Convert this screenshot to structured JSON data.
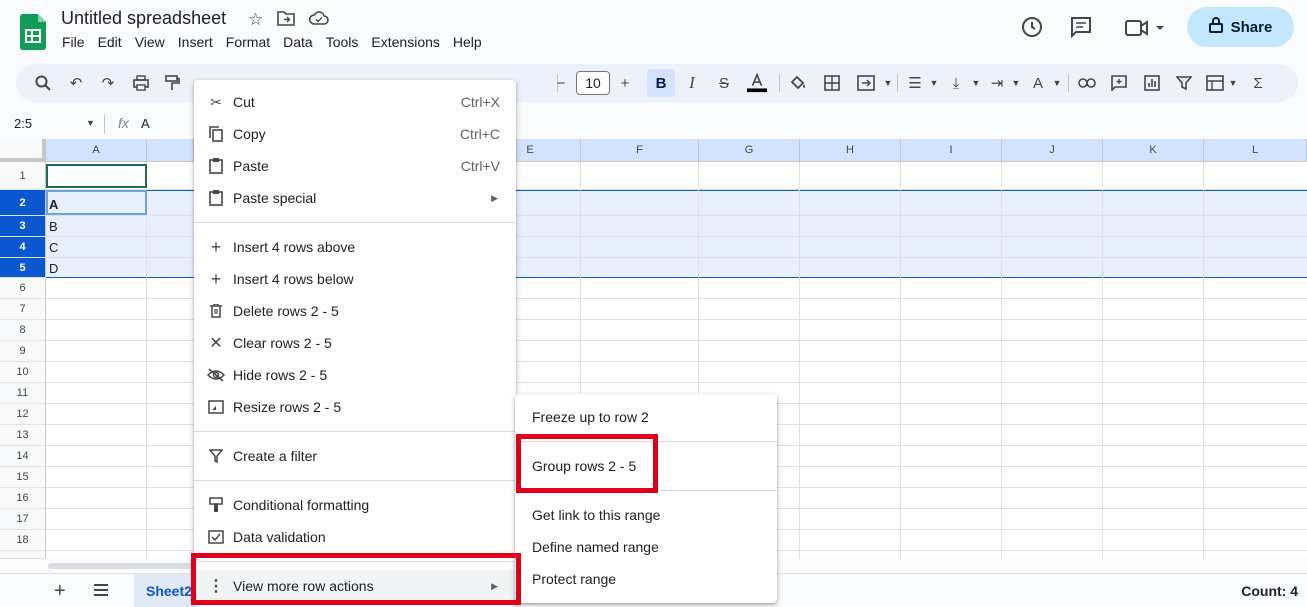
{
  "header": {
    "title": "Untitled spreadsheet",
    "menu": [
      "File",
      "Edit",
      "View",
      "Insert",
      "Format",
      "Data",
      "Tools",
      "Extensions",
      "Help"
    ],
    "share_label": "Share"
  },
  "toolbar": {
    "font_size": "10",
    "bold_label": "B"
  },
  "formula_bar": {
    "name_box": "2:5",
    "fx": "fx",
    "value": "A"
  },
  "grid": {
    "columns": [
      "A",
      "",
      "",
      "",
      "E",
      "F",
      "G",
      "H",
      "I",
      "J",
      "K",
      "L"
    ],
    "rows": [
      "1",
      "2",
      "3",
      "4",
      "5",
      "6",
      "7",
      "8",
      "9",
      "10",
      "11",
      "12",
      "13",
      "14",
      "15",
      "16",
      "17",
      "18"
    ],
    "cells": {
      "a2": "A",
      "a3": "B",
      "a4": "C",
      "a5": "D"
    }
  },
  "context_menu": {
    "items": [
      {
        "label": "Cut",
        "shortcut": "Ctrl+X"
      },
      {
        "label": "Copy",
        "shortcut": "Ctrl+C"
      },
      {
        "label": "Paste",
        "shortcut": "Ctrl+V"
      },
      {
        "label": "Paste special"
      },
      {
        "label": "Insert 4 rows above"
      },
      {
        "label": "Insert 4 rows below"
      },
      {
        "label": "Delete rows 2 - 5"
      },
      {
        "label": "Clear rows 2 - 5"
      },
      {
        "label": "Hide rows 2 - 5"
      },
      {
        "label": "Resize rows 2 - 5"
      },
      {
        "label": "Create a filter"
      },
      {
        "label": "Conditional formatting"
      },
      {
        "label": "Data validation"
      },
      {
        "label": "View more row actions"
      }
    ]
  },
  "submenu": {
    "items": [
      "Freeze up to row 2",
      "Group rows 2 - 5",
      "Get link to this range",
      "Define named range",
      "Protect range"
    ]
  },
  "footer": {
    "sheet_tab": "Sheet2",
    "status": "Count: 4"
  },
  "colors": {
    "accent": "#0b57d0",
    "share_bg": "#c2e7ff",
    "highlight": "#e0001b"
  }
}
